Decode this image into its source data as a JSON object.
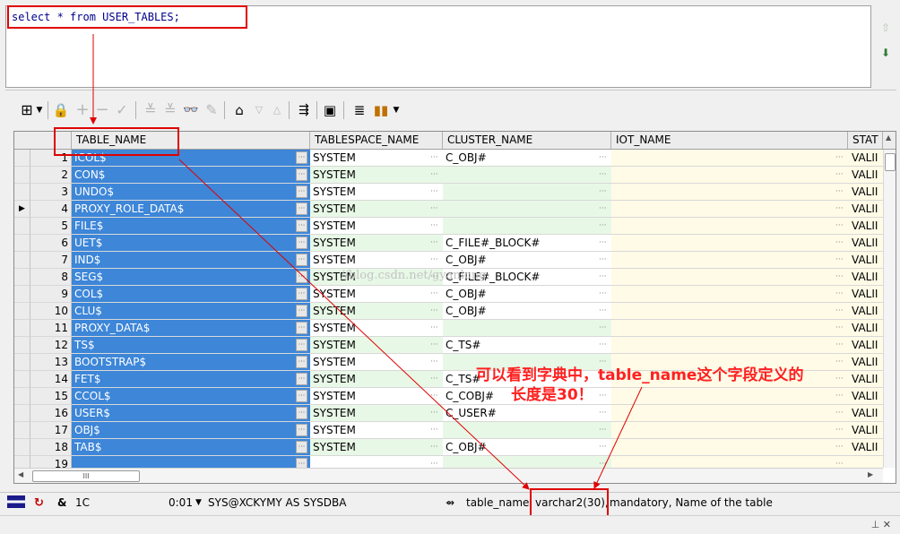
{
  "editor": {
    "sql": "select * from USER_TABLES;"
  },
  "grid": {
    "columns": [
      "TABLE_NAME",
      "TABLESPACE_NAME",
      "CLUSTER_NAME",
      "IOT_NAME",
      "STAT"
    ],
    "rows": [
      {
        "num": "1",
        "name": "ICOL$",
        "ts": "SYSTEM",
        "cluster": "C_OBJ#",
        "status": "VALII"
      },
      {
        "num": "2",
        "name": "CON$",
        "ts": "SYSTEM",
        "cluster": "",
        "status": "VALII"
      },
      {
        "num": "3",
        "name": "UNDO$",
        "ts": "SYSTEM",
        "cluster": "",
        "status": "VALII"
      },
      {
        "num": "4",
        "name": "PROXY_ROLE_DATA$",
        "ts": "SYSTEM",
        "cluster": "",
        "status": "VALII"
      },
      {
        "num": "5",
        "name": "FILE$",
        "ts": "SYSTEM",
        "cluster": "",
        "status": "VALII"
      },
      {
        "num": "6",
        "name": "UET$",
        "ts": "SYSTEM",
        "cluster": "C_FILE#_BLOCK#",
        "status": "VALII"
      },
      {
        "num": "7",
        "name": "IND$",
        "ts": "SYSTEM",
        "cluster": "C_OBJ#",
        "status": "VALII"
      },
      {
        "num": "8",
        "name": "SEG$",
        "ts": "SYSTEM",
        "cluster": "C_FILE#_BLOCK#",
        "status": "VALII"
      },
      {
        "num": "9",
        "name": "COL$",
        "ts": "SYSTEM",
        "cluster": "C_OBJ#",
        "status": "VALII"
      },
      {
        "num": "10",
        "name": "CLU$",
        "ts": "SYSTEM",
        "cluster": "C_OBJ#",
        "status": "VALII"
      },
      {
        "num": "11",
        "name": "PROXY_DATA$",
        "ts": "SYSTEM",
        "cluster": "",
        "status": "VALII"
      },
      {
        "num": "12",
        "name": "TS$",
        "ts": "SYSTEM",
        "cluster": "C_TS#",
        "status": "VALII"
      },
      {
        "num": "13",
        "name": "BOOTSTRAP$",
        "ts": "SYSTEM",
        "cluster": "",
        "status": "VALII"
      },
      {
        "num": "14",
        "name": "FET$",
        "ts": "SYSTEM",
        "cluster": "C_TS#",
        "status": "VALII"
      },
      {
        "num": "15",
        "name": "CCOL$",
        "ts": "SYSTEM",
        "cluster": "C_COBJ#",
        "status": "VALII"
      },
      {
        "num": "16",
        "name": "USER$",
        "ts": "SYSTEM",
        "cluster": "C_USER#",
        "status": "VALII"
      },
      {
        "num": "17",
        "name": "OBJ$",
        "ts": "SYSTEM",
        "cluster": "",
        "status": "VALII"
      },
      {
        "num": "18",
        "name": "TAB$",
        "ts": "SYSTEM",
        "cluster": "C_OBJ#",
        "status": "VALII"
      },
      {
        "num": "19",
        "name": "",
        "ts": "",
        "cluster": "",
        "status": ""
      }
    ],
    "current_row_marker": "▶",
    "ellipsis": "···",
    "hscroll_thumb_label": "III"
  },
  "toolbar": {
    "icons": [
      "grid-icon",
      "dropdown-arrow-icon",
      "lock-icon",
      "add-icon",
      "remove-icon",
      "checkmark-icon",
      "filter-down-icon",
      "filter-down-alt-icon",
      "binoculars-icon",
      "eraser-icon",
      "home-query-icon",
      "triangle-down-icon",
      "triangle-up-icon",
      "link-export-icon",
      "save-icon",
      "database-icon",
      "chart-icon",
      "dropdown-arrow-icon"
    ]
  },
  "status": {
    "rows_label": "1C",
    "time": "0:01",
    "connection": "SYS@XCKYMY AS SYSDBA",
    "column_info_prefix": "table_name,",
    "column_type": "varchar2(30),",
    "column_info_suffix": "mandatory, Name of the table"
  },
  "annotation": {
    "line1": "可以看到字典中，table_name这个字段定义的",
    "line2": "长度是30！"
  },
  "watermark": "//blog.csdn.net/gyanlong",
  "colors": {
    "highlight_red": "#e00000",
    "selection_blue": "#3d86d8",
    "annotation_red": "#ff2020"
  }
}
